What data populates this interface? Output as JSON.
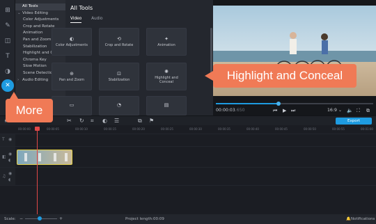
{
  "sidebar": {
    "icons": [
      "import-icon",
      "magic-wand-icon",
      "transitions-icon",
      "titles-icon",
      "filters-icon",
      "more-tools-icon"
    ],
    "active_icon": "more-tools-icon"
  },
  "tools_list": {
    "items": [
      {
        "label": "All Tools",
        "type": "head",
        "selected": true,
        "caret": ""
      },
      {
        "label": "Video Editing",
        "type": "head",
        "caret": "⌄"
      },
      {
        "label": "Color Adjustments"
      },
      {
        "label": "Crop and Rotate"
      },
      {
        "label": "Animation"
      },
      {
        "label": "Pan and Zoom"
      },
      {
        "label": "Stabilization"
      },
      {
        "label": "Highlight and Conceal"
      },
      {
        "label": "Chroma Key"
      },
      {
        "label": "Slow Motion"
      },
      {
        "label": "Scene Detection"
      },
      {
        "label": "Audio Editing",
        "type": "head",
        "caret": "›"
      }
    ]
  },
  "panel": {
    "title": "All Tools",
    "tabs": [
      {
        "label": "Video",
        "active": true
      },
      {
        "label": "Audio"
      }
    ],
    "cards": [
      {
        "label": "Color Adjustments",
        "icon": "◐"
      },
      {
        "label": "Crop and Rotate",
        "icon": "⟲"
      },
      {
        "label": "Animation",
        "icon": "✦"
      },
      {
        "label": "Pan and Zoom",
        "icon": "⊕"
      },
      {
        "label": "Stabilization",
        "icon": "⊡"
      },
      {
        "label": "Highlight and Conceal",
        "icon": "✺"
      },
      {
        "label": "",
        "icon": "▭"
      },
      {
        "label": "",
        "icon": "◔"
      },
      {
        "label": "",
        "icon": "▤"
      }
    ]
  },
  "player": {
    "time_current": "00:00:03",
    "time_frac": ".650",
    "aspect": "16:9",
    "progress": 0.4
  },
  "callouts": {
    "highlight": "Highlight and Conceal",
    "more": "More"
  },
  "toolbar": {
    "export_label": "Export"
  },
  "ruler": {
    "ticks": [
      "00:00:00",
      "00:00:05",
      "00:00:10",
      "00:00:15",
      "00:00:20",
      "00:00:25",
      "00:00:30",
      "00:00:35",
      "00:00:40",
      "00:00:45",
      "00:00:50",
      "00:00:55",
      "00:01:00"
    ]
  },
  "status": {
    "scale_label": "Scale:",
    "project_length_label": "Project length:",
    "project_length": "00:09",
    "notifications_label": "Notifications"
  },
  "colors": {
    "accent": "#1e9be0",
    "callout": "#f07a56",
    "playhead": "#e04848",
    "clip_border": "#e6d34a"
  }
}
